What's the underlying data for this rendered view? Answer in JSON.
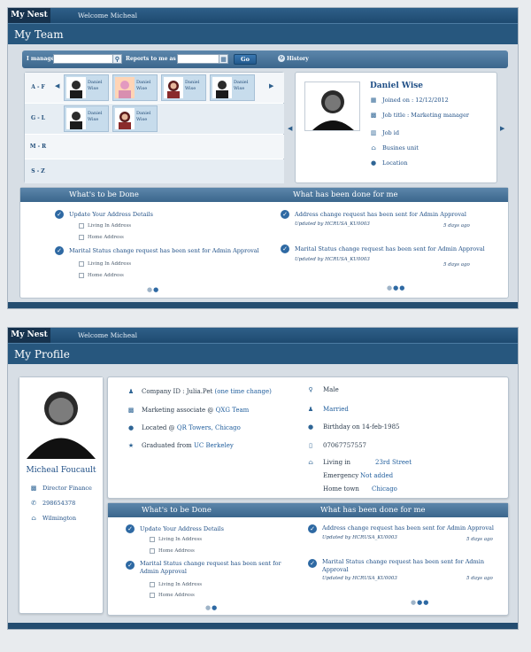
{
  "team": {
    "brand": "My Nest",
    "welcome": "Welcome Micheal",
    "title": "My Team",
    "search": {
      "i_manage": "I manage",
      "reports_to": "Reports to me as of",
      "go": "Go",
      "history": "History"
    },
    "rows": [
      {
        "label": "A - F",
        "people": [
          {
            "name1": "Daniel",
            "name2": "Wise"
          },
          {
            "name1": "Daniel",
            "name2": "Wise"
          },
          {
            "name1": "Daniel",
            "name2": "Wise"
          },
          {
            "name1": "Daniel",
            "name2": "Wise"
          }
        ]
      },
      {
        "label": "G - L",
        "people": [
          {
            "name1": "Daniel",
            "name2": "Wise"
          },
          {
            "name1": "Daniel",
            "name2": "Wise"
          }
        ]
      },
      {
        "label": "M - R",
        "people": []
      },
      {
        "label": "S - Z",
        "people": []
      }
    ],
    "detail": {
      "name": "Daniel Wise",
      "joined": "Joined on : 12/12/2012",
      "job_title": "Job title  : Marketing manager",
      "job_id": "Job id",
      "business_unit": "Busines unit",
      "location": "Location"
    },
    "todo": {
      "header": "What's to be Done",
      "items": [
        {
          "title": "Update Your Address Details",
          "subs": [
            "Living In Address",
            "Home Address"
          ]
        },
        {
          "title": "Marital Status change request has been sent for Admin Approval",
          "subs": [
            "Living In Address",
            "Home Address"
          ]
        }
      ]
    },
    "done": {
      "header": "What has been done for me",
      "items": [
        {
          "title": "Address change request has been sent for Admin Approval",
          "by": "Updated by HCRUSA_KU0003",
          "ago": "5 days ago"
        },
        {
          "title": "Marital Status change request has been sent for Admin Approval",
          "by": "Updated by HCRUSA_KU0003",
          "ago": "5 days ago"
        }
      ]
    }
  },
  "profile": {
    "brand": "My Nest",
    "welcome": "Welcome Micheal",
    "title": "My Profile",
    "name": "Micheal Foucault",
    "position": "Director Finance",
    "phone": "298654378",
    "city": "Wilmington",
    "company_id_label": "Company ID : Julia.Pet",
    "company_id_link": "(one time change)",
    "role_label": "Marketing associate @",
    "role_link": "QXG Team",
    "located_label": "Located @",
    "located_link": "QR Towers, Chicago",
    "grad_label": "Graduated from",
    "grad_link": "UC Berkeley",
    "gender": "Male",
    "marital": "Married",
    "birthday": "Birthday on 14-feb-1985",
    "mobile": "07067757557",
    "living_label": "Living in",
    "living_val": "23rd Street",
    "emergency_label": "Emergency",
    "emergency_val": "Not added",
    "hometown_label": "Home town",
    "hometown_val": "Chicago",
    "todo": {
      "header": "What's to be Done",
      "items": [
        {
          "title": "Update Your Address Details",
          "subs": [
            "Living In Address",
            "Home Address"
          ]
        },
        {
          "title": "Marital Status change request has been sent for Admin Approval",
          "subs": [
            "Living In Address",
            "Home Address"
          ]
        }
      ]
    },
    "done": {
      "header": "What has been done for me",
      "items": [
        {
          "title": "Address change request has been sent for Admin Approval",
          "by": "Updated by HCRUSA_KU0003",
          "ago": "5 days ago"
        },
        {
          "title": "Marital Status change request has been sent for Admin Approval",
          "by": "Updated by HCRUSA_KU0003",
          "ago": "5 days ago"
        }
      ]
    }
  },
  "colors": {
    "nav": "#27577e",
    "brand_bg": "#16324d",
    "accent": "#2e69a3",
    "link": "#1f5d9c"
  }
}
